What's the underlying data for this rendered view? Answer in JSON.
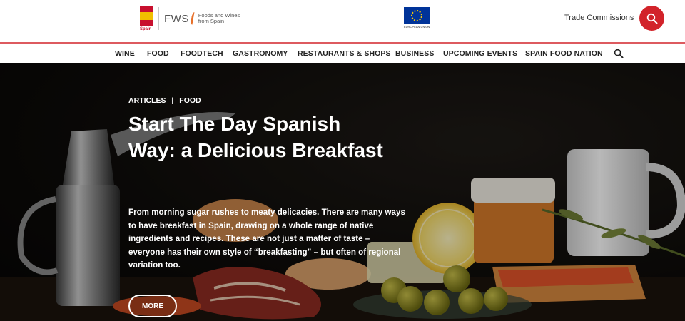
{
  "header": {
    "spain_logo_caption": "Spain",
    "fws_letters": "FWS",
    "fws_tagline": "Foods and Wines from Spain",
    "eu_caption": "EUROPEAN UNION",
    "trade_link": "Trade Commissions",
    "search_icon": "search-icon"
  },
  "nav": {
    "items": [
      "WINE",
      "FOOD",
      "FOODTECH",
      "GASTRONOMY",
      "RESTAURANTS & SHOPS",
      "BUSINESS",
      "UPCOMING EVENTS",
      "SPAIN FOOD NATION"
    ],
    "search_icon": "search-icon"
  },
  "hero": {
    "breadcrumb": [
      "ARTICLES",
      "|",
      "FOOD"
    ],
    "title": "Start The Day Spanish Way: a Delicious Breakfast",
    "description": "From morning sugar rushes to meaty delicacies. There are many ways to have breakfast in Spain, drawing on a whole range of native ingredients and recipes. These are not just a matter of taste – everyone has their own style of “breakfasting” – but often of regional variation too.",
    "more_label": "MORE"
  },
  "colors": {
    "accent": "#d2232a",
    "flag_red": "#c8102e",
    "flag_yellow": "#f1bf00",
    "eu_blue": "#003399",
    "hero_bg": "#0d0b09"
  }
}
